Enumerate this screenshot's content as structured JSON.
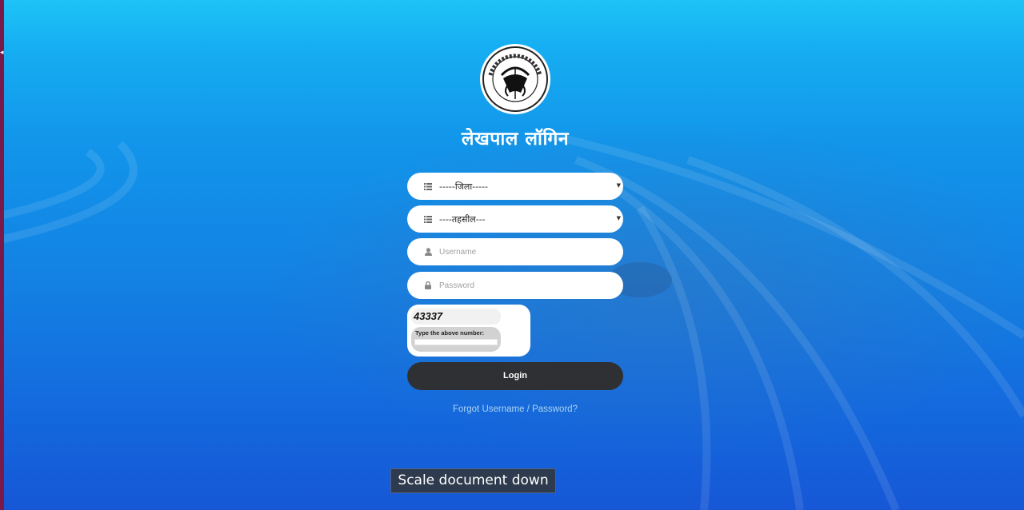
{
  "page": {
    "title": "लेखपाल लॉगिन",
    "logo_text": "उत्तर प्रदेश सरकार"
  },
  "form": {
    "district_select": {
      "selected": "-----जिला-----",
      "icon": "list-icon"
    },
    "tehsil_select": {
      "selected": "----तहसील---",
      "icon": "list-icon"
    },
    "username": {
      "placeholder": "Username",
      "value": "",
      "icon": "user-icon"
    },
    "password": {
      "placeholder": "Password",
      "value": "",
      "icon": "lock-icon"
    },
    "captcha": {
      "number": "43337",
      "label": "Type the above number:",
      "value": ""
    },
    "login_label": "Login",
    "forgot_link": "Forgot Username / Password?"
  },
  "tooltip": {
    "text": "Scale document down"
  },
  "colors": {
    "background_top": "#1ec3f7",
    "background_bottom": "#1657d6",
    "login_button": "#2f3033",
    "link": "#a9d3f1"
  }
}
